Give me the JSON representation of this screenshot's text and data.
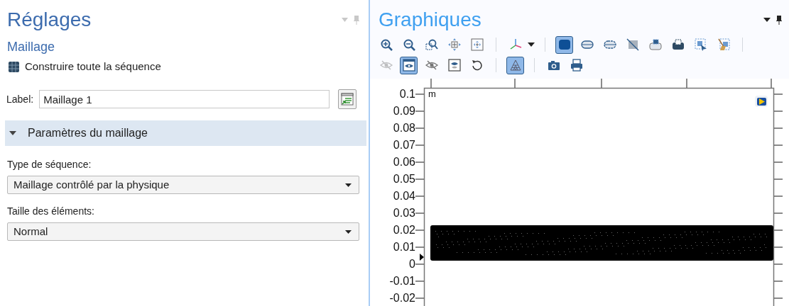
{
  "settings": {
    "title": "Réglages",
    "subtitle": "Maillage",
    "build_button": "Construire toute la séquence",
    "label_field": {
      "label": "Label:",
      "value": "Maillage 1"
    },
    "section": {
      "title": "Paramètres du maillage",
      "expanded": true
    },
    "fields": [
      {
        "label": "Type de séquence:",
        "value": "Maillage contrôlé par la physique"
      },
      {
        "label": "Taille des éléments:",
        "value": "Normal"
      }
    ]
  },
  "graphics": {
    "title": "Graphiques",
    "toolbar_rows": [
      [
        {
          "kind": "zoom-in",
          "selected": false
        },
        {
          "kind": "zoom-out",
          "selected": false
        },
        {
          "kind": "zoom-box",
          "selected": false
        },
        {
          "kind": "move",
          "selected": false
        },
        {
          "kind": "extents",
          "selected": false
        },
        {
          "kind": "sep"
        },
        {
          "kind": "axes",
          "selected": false
        },
        {
          "kind": "caret"
        },
        {
          "kind": "sep"
        },
        {
          "kind": "solid",
          "selected": true
        },
        {
          "kind": "pill",
          "selected": false
        },
        {
          "kind": "pill-dots",
          "selected": false
        },
        {
          "kind": "slash",
          "selected": false
        },
        {
          "kind": "tray",
          "selected": false
        },
        {
          "kind": "tray-dark",
          "selected": false
        },
        {
          "kind": "select-box",
          "selected": false
        },
        {
          "kind": "broom",
          "selected": false
        },
        {
          "kind": "sep"
        }
      ],
      [
        {
          "kind": "eye-off",
          "selected": false,
          "disabled": true
        },
        {
          "kind": "eye",
          "selected": true
        },
        {
          "kind": "eye-off",
          "selected": false
        },
        {
          "kind": "eye-split",
          "selected": false
        },
        {
          "kind": "undo",
          "selected": false
        },
        {
          "kind": "sep"
        },
        {
          "kind": "mesh",
          "selected": true
        },
        {
          "kind": "sep"
        },
        {
          "kind": "camera",
          "selected": false
        },
        {
          "kind": "print",
          "selected": false
        }
      ]
    ],
    "plot": {
      "unit": "m",
      "y_labels": [
        "0.1",
        "0.09",
        "0.08",
        "0.07",
        "0.06",
        "0.05",
        "0.04",
        "0.03",
        "0.02",
        "0.01",
        "0",
        "-0.01",
        "-0.02"
      ]
    }
  }
}
